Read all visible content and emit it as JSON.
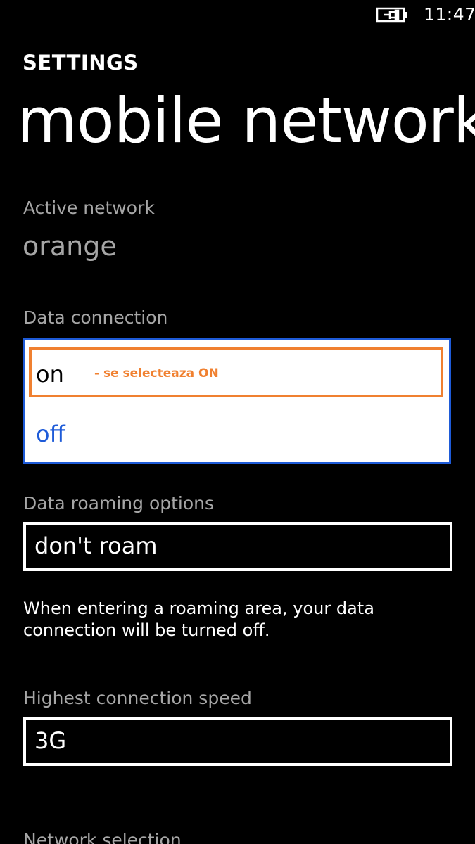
{
  "status_bar": {
    "battery_icon": "battery-charging-icon",
    "time": "11:47"
  },
  "header": {
    "app_title": "SETTINGS",
    "page_title": "mobile network"
  },
  "active_network": {
    "label": "Active network",
    "value": "orange"
  },
  "data_connection": {
    "label": "Data connection",
    "options": [
      "on",
      "off"
    ],
    "selected": "on",
    "annotation": "- se selecteaza ON"
  },
  "data_roaming": {
    "label": "Data roaming options",
    "value": "don't roam",
    "note": "When entering a roaming area, your data connection will be turned off."
  },
  "connection_speed": {
    "label": "Highest connection speed",
    "value": "3G"
  },
  "network_selection": {
    "label": "Network selection"
  },
  "colors": {
    "background": "#000000",
    "accent": "#1e5bd8",
    "annotation": "#f08030",
    "label_gray": "#a6a6a6"
  }
}
